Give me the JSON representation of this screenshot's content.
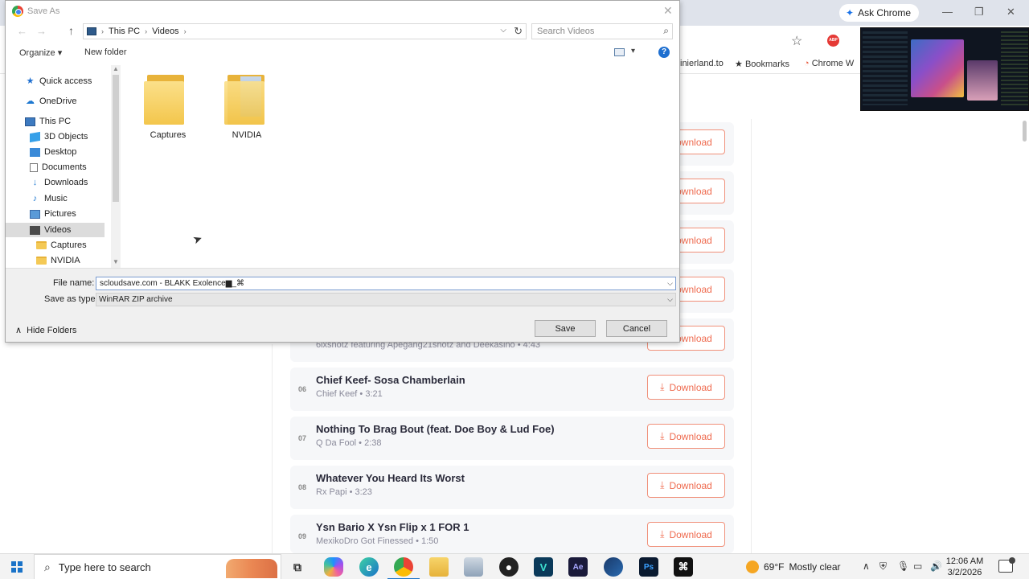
{
  "browser": {
    "ask_chrome_label": "Ask Chrome",
    "window_controls": {
      "minimize": "—",
      "maximize": "❐",
      "close": "✕"
    },
    "bookmarks_bar": [
      {
        "label": "inierland.to",
        "icon": "site-icon"
      },
      {
        "label": "Bookmarks",
        "icon": "star-icon"
      },
      {
        "label": "Chrome W",
        "icon": "chrome-web-icon"
      }
    ],
    "toolbar_icons": [
      "star-icon",
      "abp-icon"
    ],
    "abp_label": "ABP"
  },
  "page": {
    "download_label": "Download",
    "tracks": [
      {
        "num": "",
        "title": "",
        "meta": ""
      },
      {
        "num": "",
        "title": "",
        "meta": ""
      },
      {
        "num": "",
        "title": "",
        "meta": ""
      },
      {
        "num": "",
        "title": "",
        "meta": ""
      },
      {
        "num": "",
        "title": "",
        "meta": "6ixshotz featuring Apegang21shotz and Deekasino • 4:43"
      },
      {
        "num": "06",
        "title": "Chief Keef- Sosa Chamberlain",
        "meta": "Chief Keef • 3:21"
      },
      {
        "num": "07",
        "title": "Nothing To Brag Bout (feat. Doe Boy & Lud Foe)",
        "meta": "Q Da Fool • 2:38"
      },
      {
        "num": "08",
        "title": "Whatever You Heard Its Worst",
        "meta": "Rx Papi • 3:23"
      },
      {
        "num": "09",
        "title": "Ysn Bario X Ysn Flip x 1 FOR 1",
        "meta": "MexikoDro Got Finessed • 1:50"
      }
    ],
    "accent_color": "#ef6b4f"
  },
  "dialog": {
    "title": "Save As",
    "close_glyph": "✕",
    "address": {
      "segments": [
        "This PC",
        "Videos"
      ]
    },
    "search_placeholder": "Search Videos",
    "toolbar": {
      "organize": "Organize ▾",
      "new_folder": "New folder",
      "help": "?"
    },
    "nav_items": [
      {
        "label": "Quick access",
        "icon": "star-icon"
      },
      {
        "label": "OneDrive",
        "icon": "cloud-icon"
      },
      {
        "label": "This PC",
        "icon": "computer-icon"
      },
      {
        "label": "3D Objects",
        "icon": "cube-icon"
      },
      {
        "label": "Desktop",
        "icon": "desktop-icon"
      },
      {
        "label": "Documents",
        "icon": "document-icon"
      },
      {
        "label": "Downloads",
        "icon": "download-arrow-icon"
      },
      {
        "label": "Music",
        "icon": "music-note-icon"
      },
      {
        "label": "Pictures",
        "icon": "pictures-icon"
      },
      {
        "label": "Videos",
        "icon": "video-icon",
        "selected": true
      },
      {
        "label": "Captures",
        "icon": "folder-icon"
      },
      {
        "label": "NVIDIA",
        "icon": "folder-icon"
      }
    ],
    "folders": [
      "Captures",
      "NVIDIA"
    ],
    "file_name_label": "File name:",
    "file_name_value": "scloudsave.com - BLAKK Exolence▆_⌘",
    "save_as_type_label": "Save as type:",
    "save_as_type_value": "WinRAR ZIP archive",
    "hide_folders_label": "Hide Folders",
    "save_label": "Save",
    "cancel_label": "Cancel"
  },
  "taskbar": {
    "search_placeholder": "Type here to search",
    "weather": {
      "temp": "69°F",
      "condition": "Mostly clear"
    },
    "clock_time": "12:06 AM",
    "clock_date": "3/2/2026",
    "apps": [
      {
        "name": "task-view-icon",
        "label": "⧉"
      },
      {
        "name": "copilot-icon",
        "label": ""
      },
      {
        "name": "edge-icon",
        "label": "e"
      },
      {
        "name": "chrome-icon",
        "label": ""
      },
      {
        "name": "file-explorer-icon",
        "label": ""
      },
      {
        "name": "photos-icon",
        "label": ""
      },
      {
        "name": "obs-icon",
        "label": "●"
      },
      {
        "name": "vegas-icon",
        "label": "V"
      },
      {
        "name": "after-effects-icon",
        "label": "Ae"
      },
      {
        "name": "steam-icon",
        "label": ""
      },
      {
        "name": "photoshop-icon",
        "label": "Ps"
      },
      {
        "name": "capcut-icon",
        "label": "⌘"
      }
    ]
  }
}
